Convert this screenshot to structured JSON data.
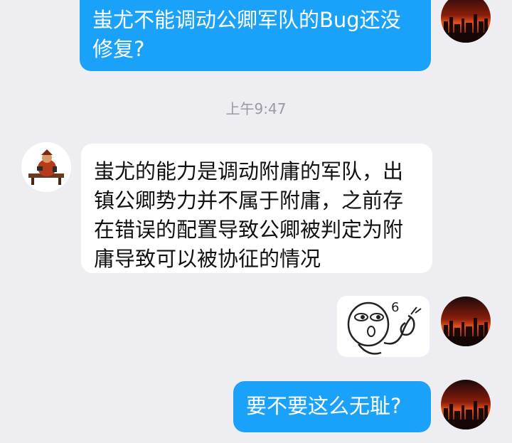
{
  "conversation": {
    "messages": [
      {
        "direction": "outgoing",
        "text": "蚩尤不能调动公卿军队的Bug还没修复?",
        "avatar_icon": "sunset-city-avatar"
      },
      {
        "direction": "incoming",
        "text": "蚩尤的能力是调动附庸的军队，出镇公卿势力并不属于附庸，之前存在错误的配置导致公卿被判定为附庸导致可以被协征的情况",
        "avatar_icon": "seated-warrior-avatar"
      },
      {
        "direction": "outgoing",
        "type": "sticker",
        "sticker_icon": "doodle-face-sticker",
        "sticker_text": "6",
        "avatar_icon": "sunset-city-avatar"
      },
      {
        "direction": "outgoing",
        "text": "要不要这么无耻?",
        "avatar_icon": "sunset-city-avatar"
      }
    ],
    "timestamp": "上午9:47"
  },
  "colors": {
    "background": "#ededf2",
    "outgoing_bubble": "#1aa2fb",
    "incoming_bubble": "#ffffff",
    "timestamp_text": "#9a9aa0"
  }
}
